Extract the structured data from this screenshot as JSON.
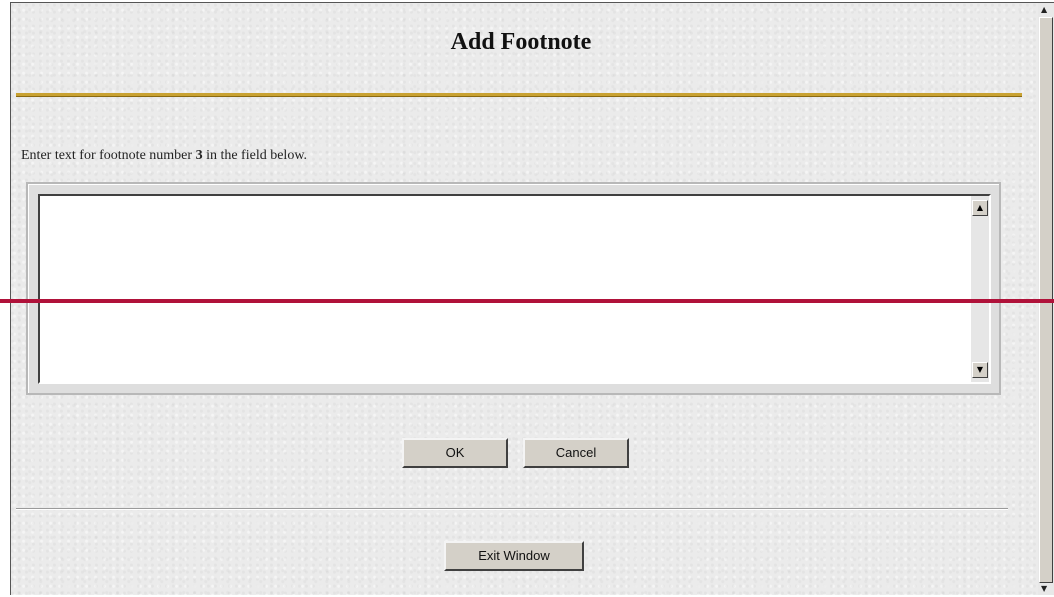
{
  "dialog": {
    "title": "Add Footnote",
    "instruction_prefix": "Enter text for footnote number ",
    "footnote_number": "3",
    "instruction_suffix": " in the field below."
  },
  "footnote_field": {
    "value": "",
    "placeholder": ""
  },
  "buttons": {
    "ok_label": "OK",
    "cancel_label": "Cancel",
    "exit_window_label": "Exit Window"
  },
  "icons": {
    "scroll_up": "▲",
    "scroll_down": "▼"
  },
  "colors": {
    "title_rule": "#c9a232",
    "overlay_line": "#b0123a",
    "background": "#ebebeb"
  }
}
